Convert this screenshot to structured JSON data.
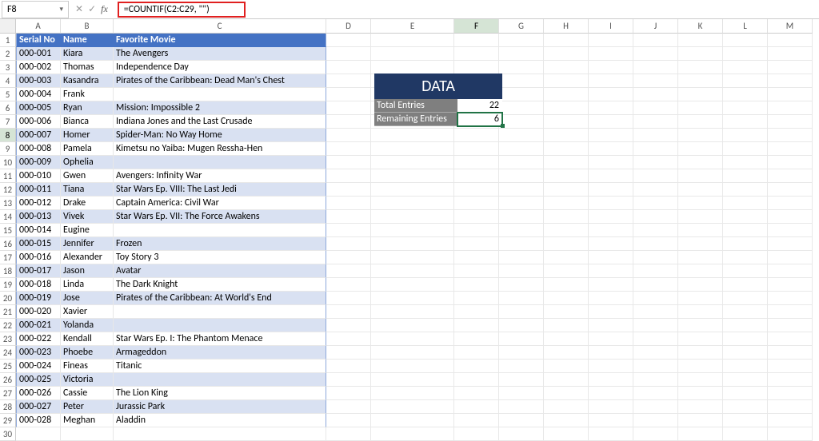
{
  "nameBox": "F8",
  "formula": "=COUNTIF(C2:C29, \"\")",
  "colHeaders": [
    "A",
    "B",
    "C",
    "D",
    "E",
    "F",
    "G",
    "H",
    "I",
    "J",
    "K",
    "L",
    "M"
  ],
  "rowCount": 30,
  "selectedRow": 8,
  "selectedCol": "F",
  "tableHeaders": {
    "A": "Serial No",
    "B": "Name",
    "C": "Favorite Movie"
  },
  "records": [
    {
      "serial": "000-001",
      "name": "Kiara",
      "movie": "The Avengers"
    },
    {
      "serial": "000-002",
      "name": "Thomas",
      "movie": "Independence Day"
    },
    {
      "serial": "000-003",
      "name": "Kasandra",
      "movie": "Pirates of the Caribbean: Dead Man's Chest"
    },
    {
      "serial": "000-004",
      "name": "Frank",
      "movie": ""
    },
    {
      "serial": "000-005",
      "name": "Ryan",
      "movie": "Mission: Impossible 2"
    },
    {
      "serial": "000-006",
      "name": "Bianca",
      "movie": "Indiana Jones and the Last Crusade"
    },
    {
      "serial": "000-007",
      "name": "Homer",
      "movie": "Spider-Man: No Way Home"
    },
    {
      "serial": "000-008",
      "name": "Pamela",
      "movie": "Kimetsu no Yaiba: Mugen Ressha-Hen"
    },
    {
      "serial": "000-009",
      "name": "Ophelia",
      "movie": ""
    },
    {
      "serial": "000-010",
      "name": "Gwen",
      "movie": "Avengers: Infinity War"
    },
    {
      "serial": "000-011",
      "name": "Tiana",
      "movie": "Star Wars Ep. VIII: The Last Jedi"
    },
    {
      "serial": "000-012",
      "name": "Drake",
      "movie": "Captain America: Civil War"
    },
    {
      "serial": "000-013",
      "name": "Vivek",
      "movie": "Star Wars Ep. VII: The Force Awakens"
    },
    {
      "serial": "000-014",
      "name": "Eugine",
      "movie": ""
    },
    {
      "serial": "000-015",
      "name": "Jennifer",
      "movie": "Frozen"
    },
    {
      "serial": "000-016",
      "name": "Alexander",
      "movie": "Toy Story 3"
    },
    {
      "serial": "000-017",
      "name": "Jason",
      "movie": "Avatar"
    },
    {
      "serial": "000-018",
      "name": "Linda",
      "movie": "The Dark Knight"
    },
    {
      "serial": "000-019",
      "name": "Jose",
      "movie": "Pirates of the Caribbean: At World's End"
    },
    {
      "serial": "000-020",
      "name": "Xavier",
      "movie": ""
    },
    {
      "serial": "000-021",
      "name": "Yolanda",
      "movie": ""
    },
    {
      "serial": "000-022",
      "name": "Kendall",
      "movie": "Star Wars Ep. I: The Phantom Menace"
    },
    {
      "serial": "000-023",
      "name": "Phoebe",
      "movie": "Armageddon"
    },
    {
      "serial": "000-024",
      "name": "Fineas",
      "movie": "Titanic"
    },
    {
      "serial": "000-025",
      "name": "Victoria",
      "movie": ""
    },
    {
      "serial": "000-026",
      "name": "Cassie",
      "movie": "The Lion King"
    },
    {
      "serial": "000-027",
      "name": "Peter",
      "movie": "Jurassic Park"
    },
    {
      "serial": "000-028",
      "name": "Meghan",
      "movie": "Aladdin"
    }
  ],
  "dataBox": {
    "title": "DATA",
    "rows": [
      {
        "label": "Total Entries",
        "value": "22"
      },
      {
        "label": "Remaining Entries",
        "value": "6"
      }
    ]
  }
}
